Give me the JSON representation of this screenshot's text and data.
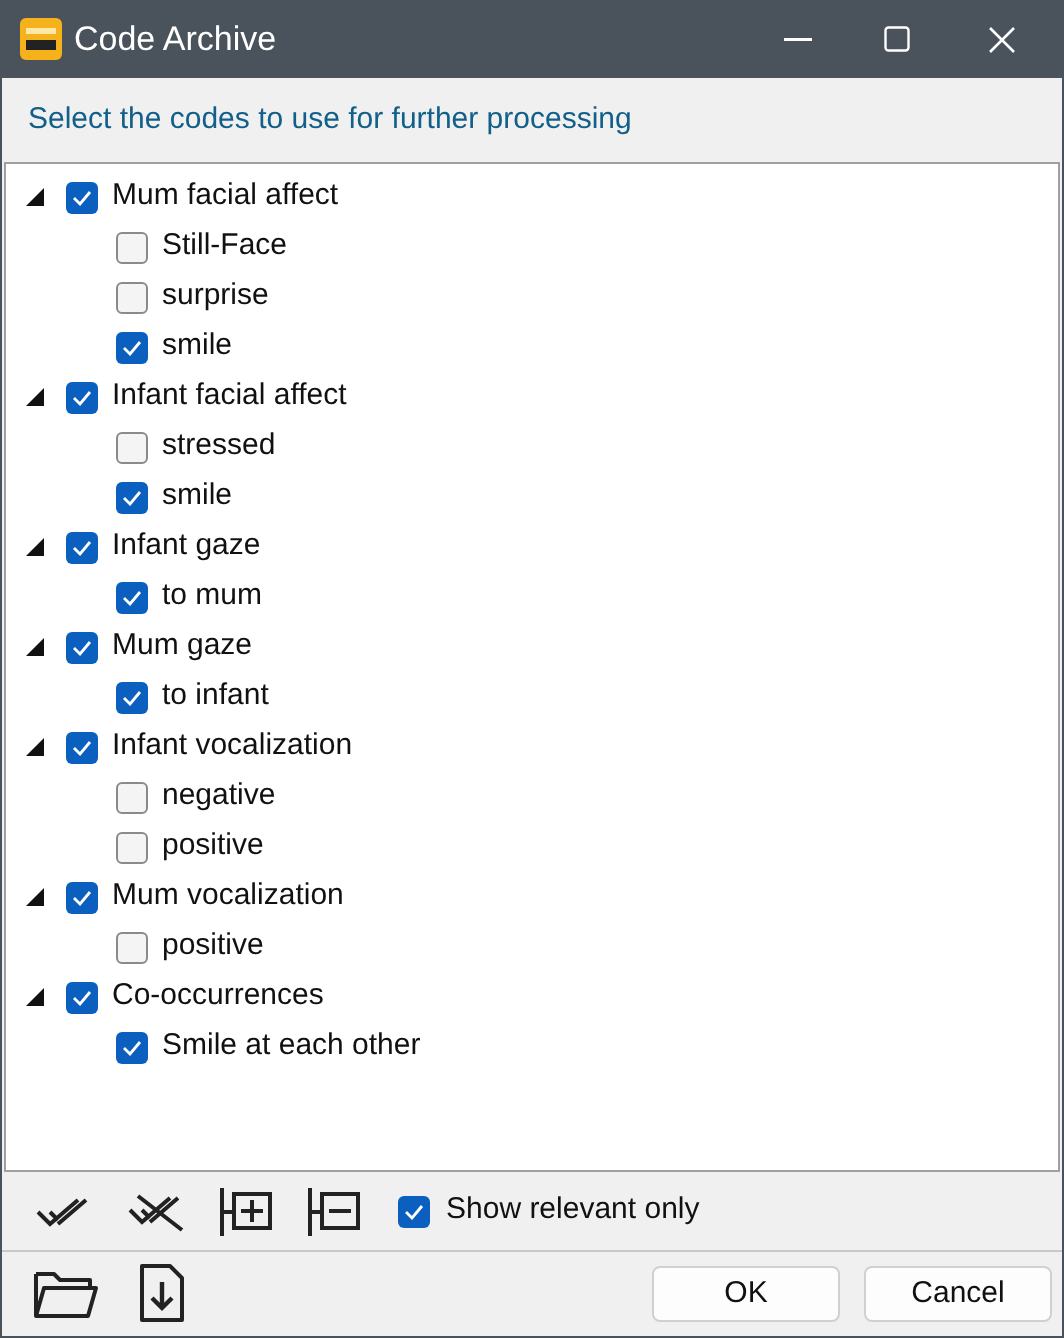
{
  "window": {
    "title": "Code Archive"
  },
  "instruction": "Select the codes to use for further processing",
  "tree": [
    {
      "label": "Mum facial affect",
      "checked": true,
      "expanded": true,
      "children": [
        {
          "label": "Still-Face",
          "checked": false
        },
        {
          "label": "surprise",
          "checked": false
        },
        {
          "label": "smile",
          "checked": true
        }
      ]
    },
    {
      "label": "Infant facial affect",
      "checked": true,
      "expanded": true,
      "children": [
        {
          "label": "stressed",
          "checked": false
        },
        {
          "label": "smile",
          "checked": true
        }
      ]
    },
    {
      "label": "Infant gaze",
      "checked": true,
      "expanded": true,
      "children": [
        {
          "label": "to mum",
          "checked": true
        }
      ]
    },
    {
      "label": "Mum gaze",
      "checked": true,
      "expanded": true,
      "children": [
        {
          "label": "to infant",
          "checked": true
        }
      ]
    },
    {
      "label": "Infant vocalization",
      "checked": true,
      "expanded": true,
      "children": [
        {
          "label": "negative",
          "checked": false
        },
        {
          "label": "positive",
          "checked": false
        }
      ]
    },
    {
      "label": "Mum vocalization",
      "checked": true,
      "expanded": true,
      "children": [
        {
          "label": "positive",
          "checked": false
        }
      ]
    },
    {
      "label": "Co-occurrences",
      "checked": true,
      "expanded": true,
      "children": [
        {
          "label": "Smile at each other",
          "checked": true
        }
      ]
    }
  ],
  "show_relevant_only": {
    "label": "Show relevant only",
    "checked": true
  },
  "buttons": [
    "OK",
    "Cancel"
  ]
}
